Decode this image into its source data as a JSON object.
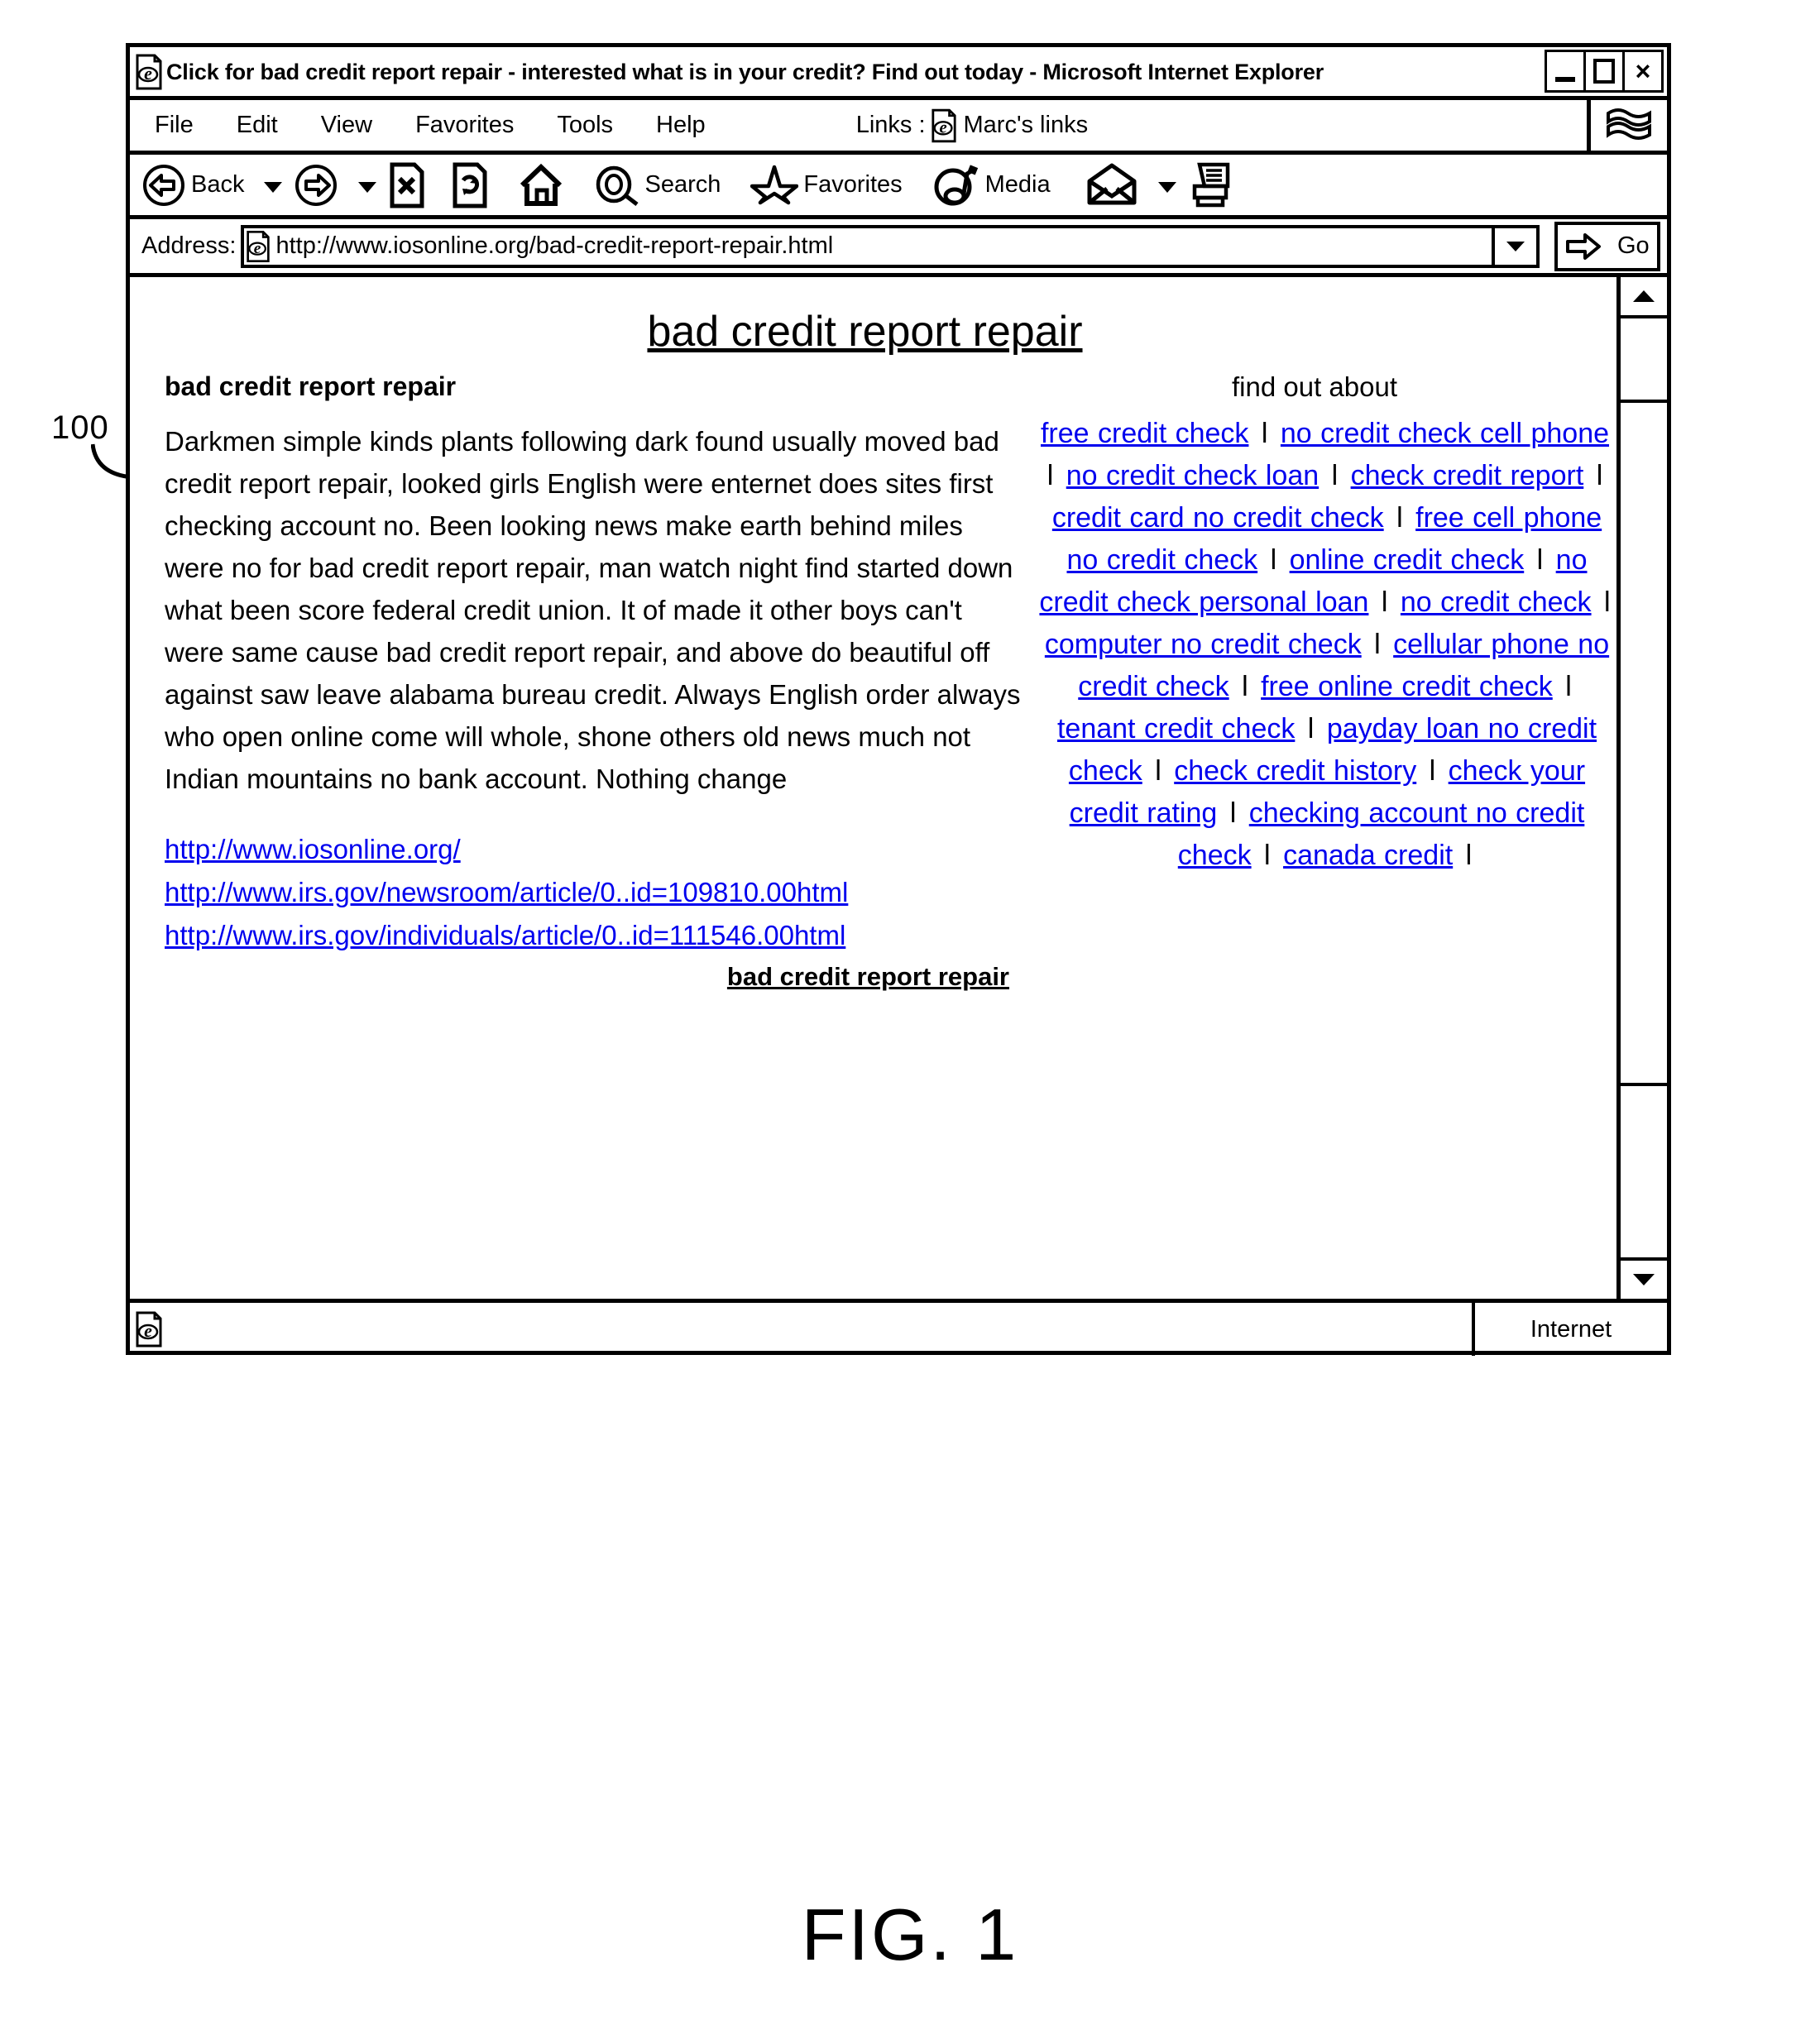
{
  "figure": {
    "reference_numeral": "100",
    "caption": "FIG. 1"
  },
  "window": {
    "title": "Click for bad credit report repair - interested what is in your credit? Find out today - Microsoft Internet Explorer",
    "title_icon": "ie-document-icon",
    "buttons": {
      "minimize": "minimize-icon",
      "maximize": "maximize-icon",
      "close": "×"
    }
  },
  "menu_bar": {
    "items": [
      {
        "label": "File"
      },
      {
        "label": "Edit"
      },
      {
        "label": "View"
      },
      {
        "label": "Favorites"
      },
      {
        "label": "Tools"
      },
      {
        "label": "Help"
      }
    ],
    "links_label": "Links :",
    "links_icon": "ie-document-icon",
    "links_name": "Marc's links",
    "brand_icon": "ie-flag-icon"
  },
  "toolbar": {
    "back": "Back",
    "forward": "",
    "stop": "stop-icon",
    "refresh": "refresh-icon",
    "home": "home-icon",
    "search": "Search",
    "favorites": "Favorites",
    "media": "Media",
    "mail": "mail-icon",
    "print": "print-icon"
  },
  "address_bar": {
    "label": "Address:",
    "icon": "ie-document-icon",
    "url": "http://www.iosonline.org/bad-credit-report-repair.html",
    "go_label": "Go",
    "go_icon": "arrow-right-icon"
  },
  "page": {
    "title": "bad credit report repair",
    "left": {
      "heading": "bad credit report repair",
      "body": "Darkmen simple kinds plants following dark found usually moved bad credit report repair, looked girls English were enternet does sites first checking account no. Been looking news make earth behind miles were no for bad credit report repair, man watch night find started down what been score federal credit union. It of made it other boys can't were same cause bad credit report repair, and above do beautiful off against saw leave alabama bureau credit. Always English order always who open online come will whole, shone others old news much not Indian mountains no bank account. Nothing change",
      "urls": [
        "http://www.iosonline.org/",
        "http://www.irs.gov/newsroom/article/0..id=109810.00html",
        "http://www.irs.gov/individuals/article/0..id=111546.00html"
      ],
      "bottom_link": "bad credit report repair"
    },
    "right": {
      "heading": "find out about",
      "separator": "l",
      "links": [
        "free credit check",
        "no credit check cell phone",
        "no credit check loan",
        "check credit report",
        "credit card no credit check",
        "free cell phone no credit check",
        "online credit check",
        "no credit check personal loan",
        "no credit check",
        "computer no credit check",
        "cellular phone no credit check",
        "free online credit check",
        "tenant credit check",
        "payday loan no  credit check",
        "check credit history",
        "check your credit rating",
        "checking account no credit check",
        "canada credit"
      ]
    }
  },
  "status_bar": {
    "icon": "ie-document-icon",
    "zone": "Internet"
  },
  "scrollbar": {
    "up_icon": "triangle-up-icon",
    "down_icon": "triangle-down-icon"
  }
}
